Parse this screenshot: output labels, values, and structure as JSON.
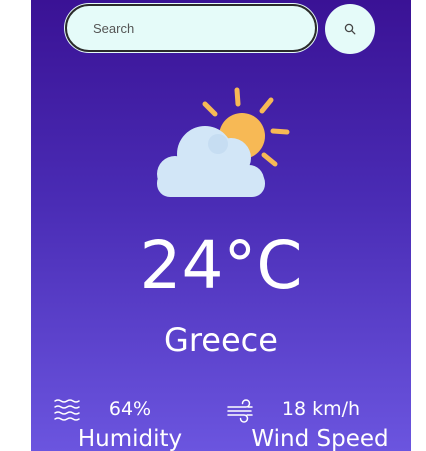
{
  "search": {
    "placeholder": "Search",
    "value": "",
    "button_icon": "search-icon"
  },
  "weather": {
    "icon": "partly-cloudy-sun-icon",
    "temperature": "24°C",
    "city": "Greece"
  },
  "stats": {
    "humidity": {
      "icon": "humidity-waves-icon",
      "value": "64%",
      "label": "Humidity"
    },
    "wind": {
      "icon": "wind-icon",
      "value": "18 km/h",
      "label": "Wind Speed"
    }
  },
  "colors": {
    "gradient_top": "#3a1295",
    "gradient_bottom": "#6b55df",
    "search_bg": "#e5fbf9",
    "sun": "#f7b955",
    "cloud": "#d2e6f7"
  }
}
